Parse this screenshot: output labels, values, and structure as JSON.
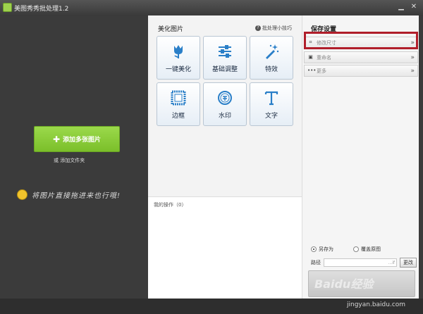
{
  "window": {
    "title": "美图秀秀批处理1.2",
    "minimize": "▁",
    "close": "✕"
  },
  "left": {
    "add_button": "添加多张图片",
    "or_text": "或",
    "add_folder": "添加文件夹",
    "drag_hint": "将图片直接拖进来也行哦!"
  },
  "middle": {
    "section_title": "美化图片",
    "tips_label": "批处理小技巧",
    "tools": [
      {
        "label": "一键美化",
        "icon": "tulip-icon"
      },
      {
        "label": "基础调整",
        "icon": "sliders-icon"
      },
      {
        "label": "特效",
        "icon": "magic-wand-icon"
      },
      {
        "label": "边框",
        "icon": "frame-icon"
      },
      {
        "label": "水印",
        "icon": "watermark-stamp-icon"
      },
      {
        "label": "文字",
        "icon": "text-t-icon"
      }
    ],
    "operations_label": "我的操作（0）"
  },
  "right": {
    "section_title": "保存设置",
    "rows": [
      {
        "label": "修改尺寸",
        "icon": "crop-icon"
      },
      {
        "label": "重命名",
        "icon": "rename-icon"
      },
      {
        "label": "更多",
        "icon": "more-dots-icon"
      }
    ],
    "save_as": "另存为",
    "overwrite": "覆盖原图",
    "path_label": "路径",
    "path_value": "...if",
    "change_button": "更改"
  },
  "watermark": {
    "main": "Baidu经验",
    "sub": "jingyan.baidu.com"
  }
}
